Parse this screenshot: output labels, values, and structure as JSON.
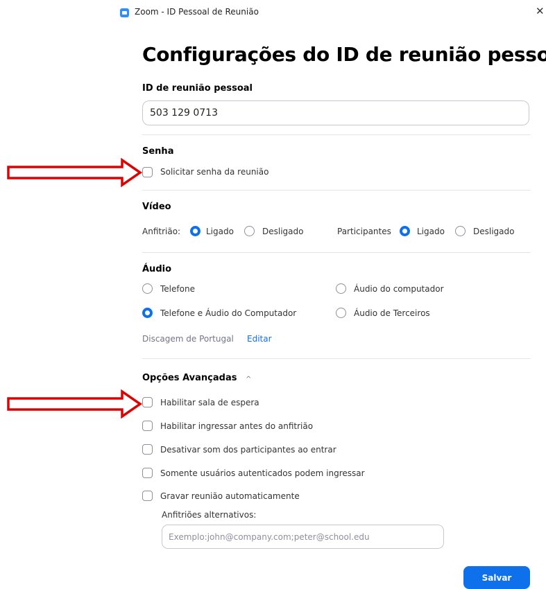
{
  "window": {
    "title": "Zoom - ID Pessoal de Reunião"
  },
  "page_title": "Configurações do ID de reunião pessoal",
  "pmi": {
    "label": "ID de reunião pessoal",
    "value": "503 129 0713"
  },
  "password": {
    "section_label": "Senha",
    "require_label": "Solicitar senha da reunião"
  },
  "video": {
    "section_label": "Vídeo",
    "host_label": "Anfitrião:",
    "participants_label": "Participantes",
    "on_label": "Ligado",
    "off_label": "Desligado",
    "host_selected": "Ligado",
    "participants_selected": "Ligado"
  },
  "audio": {
    "section_label": "Áudio",
    "opt_telephone": "Telefone",
    "opt_computer": "Áudio do computador",
    "opt_both": "Telefone e Áudio do Computador",
    "opt_third": "Áudio de Terceiros",
    "selected": "Telefone e Áudio do Computador",
    "dial_in_text": "Discagem de Portugal",
    "edit_link": "Editar"
  },
  "advanced": {
    "section_label": "Opções Avançadas",
    "waiting_room": "Habilitar sala de espera",
    "join_before_host": "Habilitar ingressar antes do anfitrião",
    "mute_on_entry": "Desativar som dos participantes ao entrar",
    "authenticated_only": "Somente usuários autenticados podem ingressar",
    "auto_record": "Gravar reunião automaticamente",
    "alt_hosts_label": "Anfitriões alternativos:",
    "alt_hosts_placeholder": "Exemplo:john@company.com;peter@school.edu"
  },
  "save_label": "Salvar",
  "colors": {
    "accent": "#0e71eb",
    "annotation_arrow": "#e00000"
  }
}
